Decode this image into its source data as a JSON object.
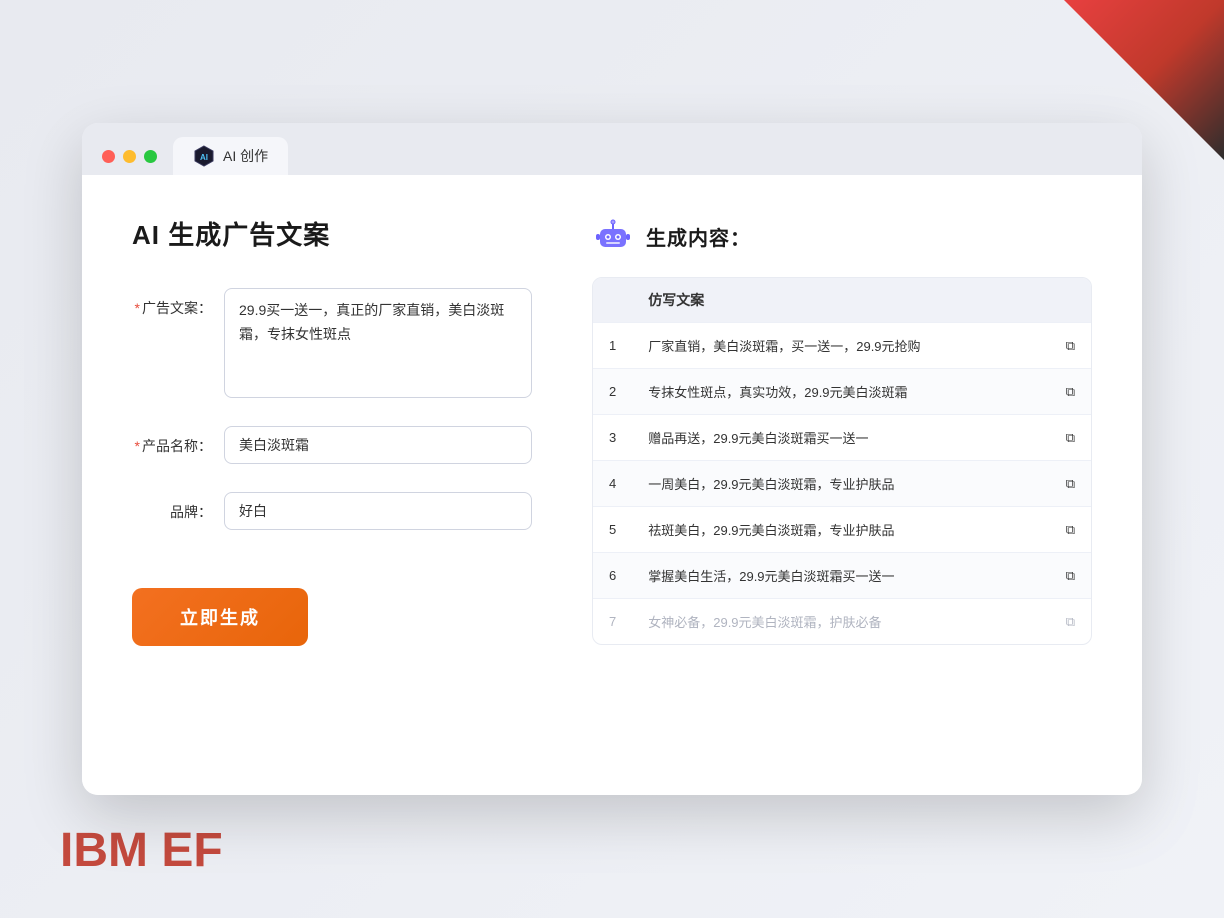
{
  "decorative": {
    "ibm_ef": "IBM EF"
  },
  "browser": {
    "tab_title": "AI 创作",
    "traffic_lights": [
      "red",
      "yellow",
      "green"
    ]
  },
  "page": {
    "title": "AI 生成广告文案",
    "form": {
      "ad_copy_label": "广告文案：",
      "ad_copy_required": true,
      "ad_copy_value": "29.9买一送一，真正的厂家直销，美白淡斑霜，专抹女性斑点",
      "product_name_label": "产品名称：",
      "product_name_required": true,
      "product_name_value": "美白淡斑霜",
      "brand_label": "品牌：",
      "brand_required": false,
      "brand_value": "好白",
      "generate_button": "立即生成"
    },
    "result": {
      "icon": "robot",
      "title": "生成内容：",
      "table_header": "仿写文案",
      "items": [
        {
          "id": 1,
          "text": "厂家直销，美白淡斑霜，买一送一，29.9元抢购",
          "faded": false
        },
        {
          "id": 2,
          "text": "专抹女性斑点，真实功效，29.9元美白淡斑霜",
          "faded": false
        },
        {
          "id": 3,
          "text": "赠品再送，29.9元美白淡斑霜买一送一",
          "faded": false
        },
        {
          "id": 4,
          "text": "一周美白，29.9元美白淡斑霜，专业护肤品",
          "faded": false
        },
        {
          "id": 5,
          "text": "祛斑美白，29.9元美白淡斑霜，专业护肤品",
          "faded": false
        },
        {
          "id": 6,
          "text": "掌握美白生活，29.9元美白淡斑霜买一送一",
          "faded": false
        },
        {
          "id": 7,
          "text": "女神必备，29.9元美白淡斑霜，护肤必备",
          "faded": true
        }
      ]
    }
  }
}
